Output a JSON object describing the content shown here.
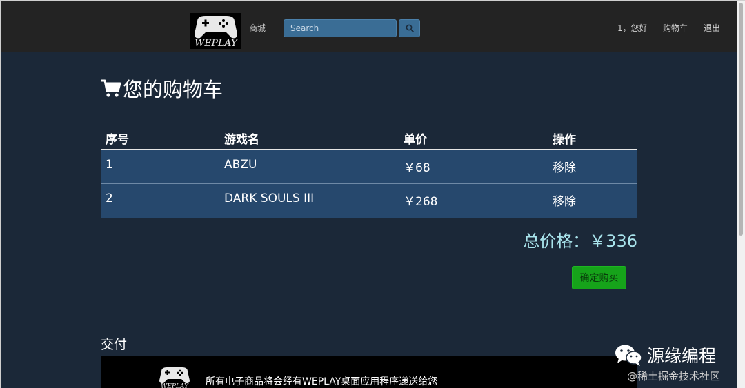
{
  "header": {
    "nav_store": "商城",
    "search_placeholder": "Search",
    "greeting": "1，您好",
    "nav_cart": "购物车",
    "nav_logout": "退出"
  },
  "cart": {
    "title": "您的购物车",
    "columns": [
      "序号",
      "游戏名",
      "单价",
      "操作"
    ],
    "rows": [
      {
        "index": "1",
        "name": "ABZU",
        "price": "￥68",
        "action": "移除"
      },
      {
        "index": "2",
        "name": "DARK SOULS III",
        "price": "￥268",
        "action": "移除"
      }
    ],
    "total": "总价格：￥336",
    "confirm_label": "确定购买"
  },
  "delivery": {
    "heading": "交付",
    "text": "所有电子商品将会经有WEPLAY桌面应用程序递送给您"
  },
  "watermark": {
    "account": "源缘编程",
    "site": "@稀土掘金技术社区"
  },
  "colors": {
    "background": "#1b2838",
    "navbar": "#232323",
    "row": "#26486d",
    "confirm": "#16a31a",
    "total": "#a9e4ec"
  }
}
